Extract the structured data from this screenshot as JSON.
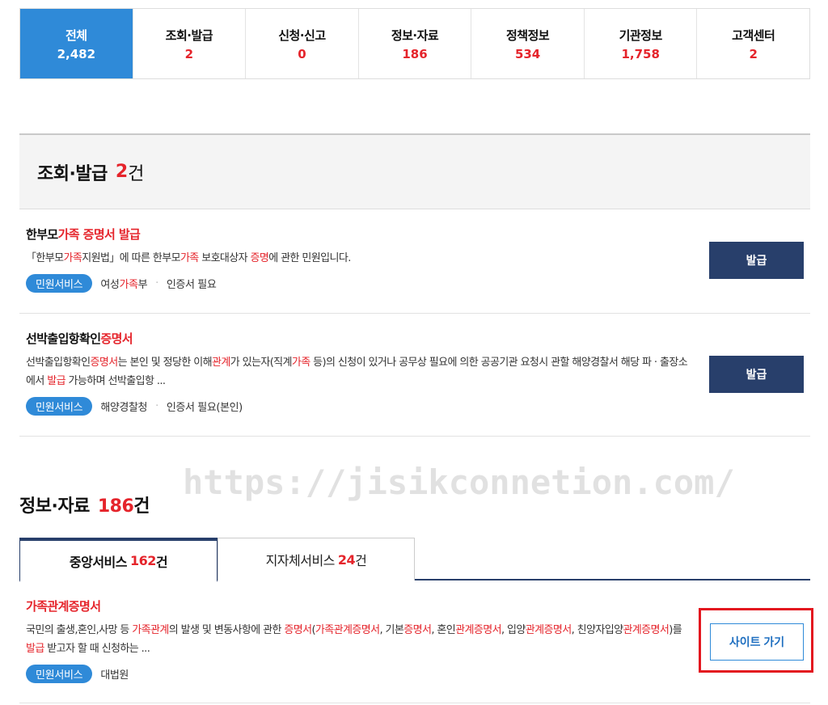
{
  "categories": [
    {
      "label": "전체",
      "count": "2,482"
    },
    {
      "label": "조회·발급",
      "count": "2"
    },
    {
      "label": "신청·신고",
      "count": "0"
    },
    {
      "label": "정보·자료",
      "count": "186"
    },
    {
      "label": "정책정보",
      "count": "534"
    },
    {
      "label": "기관정보",
      "count": "1,758"
    },
    {
      "label": "고객센터",
      "count": "2"
    }
  ],
  "issue_section": {
    "title": "조회·발급",
    "count": "2",
    "unit": "건"
  },
  "items": [
    {
      "title_parts": [
        "한부모",
        "가족 증명서 발급"
      ],
      "desc_parts": [
        "「한부모",
        "가족",
        "지원법」에 따른 한부모",
        "가족",
        " 보호대상자 ",
        "증명",
        "에 관한 민원입니다."
      ],
      "badge": "민원서비스",
      "agency_parts": [
        "여성",
        "가족",
        "부"
      ],
      "note": "인증서 필요",
      "button": "발급"
    },
    {
      "title_parts": [
        "선박출입항확인",
        "증명서"
      ],
      "desc_parts": [
        "선박출입항확인",
        "증명서",
        "는 본인 및 정당한 이해",
        "관계",
        "가 있는자(직계",
        "가족",
        " 등)의 신청이 있거나 공무상 필요에 의한 공공기관 요청시 관할 해양경찰서 해당 파 · 출장소에서 ",
        "발급",
        " 가능하며 선박출입항 ..."
      ],
      "badge": "민원서비스",
      "agency": "해양경찰청",
      "note": "인증서 필요(본인)",
      "button": "발급"
    }
  ],
  "watermark": "https://jisikconnetion.com/",
  "info_section": {
    "title": "정보·자료",
    "count": "186",
    "unit": "건"
  },
  "sub_tabs": [
    {
      "label": "중앙서비스",
      "count": "162",
      "unit": "건"
    },
    {
      "label": "지자체서비스",
      "count": "24",
      "unit": "건"
    }
  ],
  "info_item": {
    "title": "가족관계증명서",
    "desc_parts": [
      "국민의 출생,혼인,사망 등 ",
      "가족관계",
      "의 발생 및 변동사항에 관한 ",
      "증명서",
      "(",
      "가족관계증명서",
      ", 기본",
      "증명서",
      ", 혼인",
      "관계증명서",
      ", 입양",
      "관계증명서",
      ", 친양자입양",
      "관계증명서",
      ")를 ",
      "발급",
      " 받고자 할 때 신청하는 ..."
    ],
    "badge": "민원서비스",
    "agency": "대법원",
    "button": "사이트 가기"
  },
  "colors": {
    "accent_blue": "#2f8ad8",
    "navy": "#283f6b",
    "highlight_red": "#e5242b",
    "callout_red": "#e3161f"
  }
}
